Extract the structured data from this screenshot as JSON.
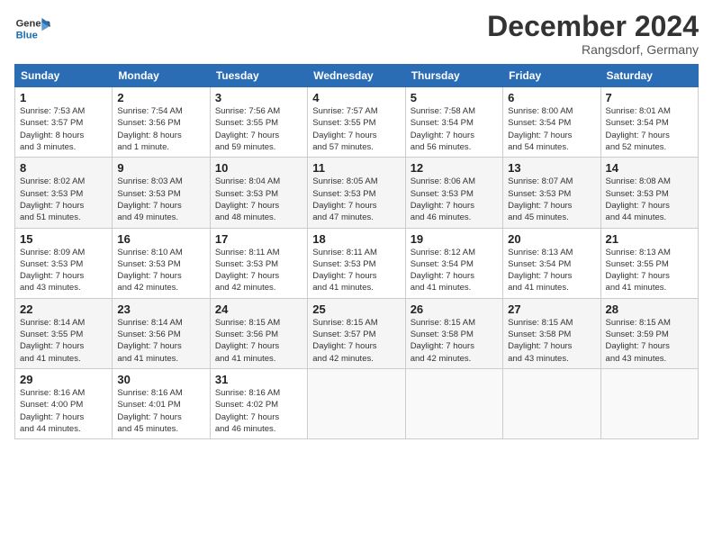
{
  "header": {
    "logo_line1": "General",
    "logo_line2": "Blue",
    "title": "December 2024",
    "subtitle": "Rangsdorf, Germany"
  },
  "weekdays": [
    "Sunday",
    "Monday",
    "Tuesday",
    "Wednesday",
    "Thursday",
    "Friday",
    "Saturday"
  ],
  "weeks": [
    [
      {
        "day": "1",
        "info": "Sunrise: 7:53 AM\nSunset: 3:57 PM\nDaylight: 8 hours\nand 3 minutes."
      },
      {
        "day": "2",
        "info": "Sunrise: 7:54 AM\nSunset: 3:56 PM\nDaylight: 8 hours\nand 1 minute."
      },
      {
        "day": "3",
        "info": "Sunrise: 7:56 AM\nSunset: 3:55 PM\nDaylight: 7 hours\nand 59 minutes."
      },
      {
        "day": "4",
        "info": "Sunrise: 7:57 AM\nSunset: 3:55 PM\nDaylight: 7 hours\nand 57 minutes."
      },
      {
        "day": "5",
        "info": "Sunrise: 7:58 AM\nSunset: 3:54 PM\nDaylight: 7 hours\nand 56 minutes."
      },
      {
        "day": "6",
        "info": "Sunrise: 8:00 AM\nSunset: 3:54 PM\nDaylight: 7 hours\nand 54 minutes."
      },
      {
        "day": "7",
        "info": "Sunrise: 8:01 AM\nSunset: 3:54 PM\nDaylight: 7 hours\nand 52 minutes."
      }
    ],
    [
      {
        "day": "8",
        "info": "Sunrise: 8:02 AM\nSunset: 3:53 PM\nDaylight: 7 hours\nand 51 minutes."
      },
      {
        "day": "9",
        "info": "Sunrise: 8:03 AM\nSunset: 3:53 PM\nDaylight: 7 hours\nand 49 minutes."
      },
      {
        "day": "10",
        "info": "Sunrise: 8:04 AM\nSunset: 3:53 PM\nDaylight: 7 hours\nand 48 minutes."
      },
      {
        "day": "11",
        "info": "Sunrise: 8:05 AM\nSunset: 3:53 PM\nDaylight: 7 hours\nand 47 minutes."
      },
      {
        "day": "12",
        "info": "Sunrise: 8:06 AM\nSunset: 3:53 PM\nDaylight: 7 hours\nand 46 minutes."
      },
      {
        "day": "13",
        "info": "Sunrise: 8:07 AM\nSunset: 3:53 PM\nDaylight: 7 hours\nand 45 minutes."
      },
      {
        "day": "14",
        "info": "Sunrise: 8:08 AM\nSunset: 3:53 PM\nDaylight: 7 hours\nand 44 minutes."
      }
    ],
    [
      {
        "day": "15",
        "info": "Sunrise: 8:09 AM\nSunset: 3:53 PM\nDaylight: 7 hours\nand 43 minutes."
      },
      {
        "day": "16",
        "info": "Sunrise: 8:10 AM\nSunset: 3:53 PM\nDaylight: 7 hours\nand 42 minutes."
      },
      {
        "day": "17",
        "info": "Sunrise: 8:11 AM\nSunset: 3:53 PM\nDaylight: 7 hours\nand 42 minutes."
      },
      {
        "day": "18",
        "info": "Sunrise: 8:11 AM\nSunset: 3:53 PM\nDaylight: 7 hours\nand 41 minutes."
      },
      {
        "day": "19",
        "info": "Sunrise: 8:12 AM\nSunset: 3:54 PM\nDaylight: 7 hours\nand 41 minutes."
      },
      {
        "day": "20",
        "info": "Sunrise: 8:13 AM\nSunset: 3:54 PM\nDaylight: 7 hours\nand 41 minutes."
      },
      {
        "day": "21",
        "info": "Sunrise: 8:13 AM\nSunset: 3:55 PM\nDaylight: 7 hours\nand 41 minutes."
      }
    ],
    [
      {
        "day": "22",
        "info": "Sunrise: 8:14 AM\nSunset: 3:55 PM\nDaylight: 7 hours\nand 41 minutes."
      },
      {
        "day": "23",
        "info": "Sunrise: 8:14 AM\nSunset: 3:56 PM\nDaylight: 7 hours\nand 41 minutes."
      },
      {
        "day": "24",
        "info": "Sunrise: 8:15 AM\nSunset: 3:56 PM\nDaylight: 7 hours\nand 41 minutes."
      },
      {
        "day": "25",
        "info": "Sunrise: 8:15 AM\nSunset: 3:57 PM\nDaylight: 7 hours\nand 42 minutes."
      },
      {
        "day": "26",
        "info": "Sunrise: 8:15 AM\nSunset: 3:58 PM\nDaylight: 7 hours\nand 42 minutes."
      },
      {
        "day": "27",
        "info": "Sunrise: 8:15 AM\nSunset: 3:58 PM\nDaylight: 7 hours\nand 43 minutes."
      },
      {
        "day": "28",
        "info": "Sunrise: 8:15 AM\nSunset: 3:59 PM\nDaylight: 7 hours\nand 43 minutes."
      }
    ],
    [
      {
        "day": "29",
        "info": "Sunrise: 8:16 AM\nSunset: 4:00 PM\nDaylight: 7 hours\nand 44 minutes."
      },
      {
        "day": "30",
        "info": "Sunrise: 8:16 AM\nSunset: 4:01 PM\nDaylight: 7 hours\nand 45 minutes."
      },
      {
        "day": "31",
        "info": "Sunrise: 8:16 AM\nSunset: 4:02 PM\nDaylight: 7 hours\nand 46 minutes."
      },
      {
        "day": "",
        "info": ""
      },
      {
        "day": "",
        "info": ""
      },
      {
        "day": "",
        "info": ""
      },
      {
        "day": "",
        "info": ""
      }
    ]
  ]
}
